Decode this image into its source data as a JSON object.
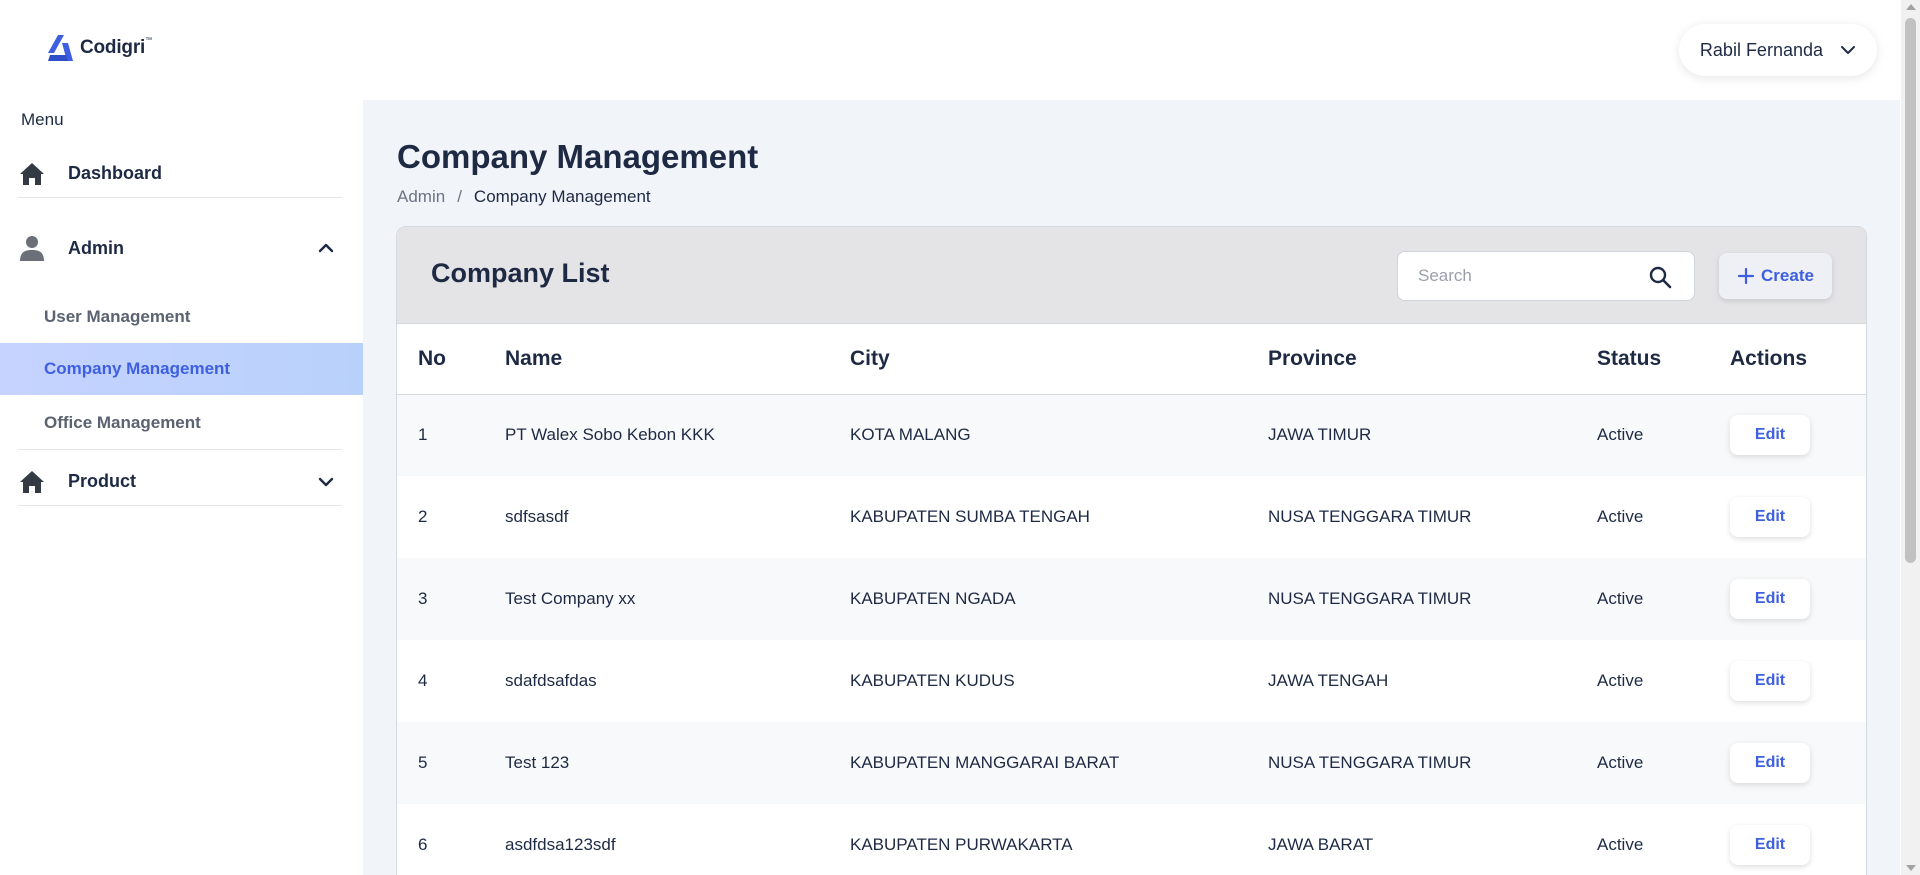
{
  "app": {
    "logo_text": "Codigri",
    "logo_tm": "™"
  },
  "sidebar": {
    "menu_label": "Menu",
    "items": [
      {
        "label": "Dashboard",
        "icon": "home-icon"
      },
      {
        "label": "Admin",
        "icon": "user-icon",
        "expanded": true
      },
      {
        "label": "Product",
        "icon": "home-icon",
        "expanded": false
      }
    ],
    "admin_subitems": [
      {
        "label": "User Management"
      },
      {
        "label": "Company Management",
        "active": true
      },
      {
        "label": "Office Management"
      }
    ]
  },
  "header": {
    "user_name": "Rabil Fernanda"
  },
  "page": {
    "title": "Company Management",
    "breadcrumb": [
      "Admin",
      "/",
      "Company Management"
    ]
  },
  "card": {
    "title": "Company List",
    "search_placeholder": "Search",
    "create_label": "Create"
  },
  "table": {
    "columns": [
      "No",
      "Name",
      "City",
      "Province",
      "Status",
      "Actions"
    ],
    "edit_label": "Edit",
    "rows": [
      {
        "no": "1",
        "name": "PT Walex Sobo Kebon KKK",
        "city": "KOTA MALANG",
        "province": "JAWA TIMUR",
        "status": "Active"
      },
      {
        "no": "2",
        "name": "sdfsasdf",
        "city": "KABUPATEN SUMBA TENGAH",
        "province": "NUSA TENGGARA TIMUR",
        "status": "Active"
      },
      {
        "no": "3",
        "name": "Test Company xx",
        "city": "KABUPATEN NGADA",
        "province": "NUSA TENGGARA TIMUR",
        "status": "Active"
      },
      {
        "no": "4",
        "name": "sdafdsafdas",
        "city": "KABUPATEN KUDUS",
        "province": "JAWA TENGAH",
        "status": "Active"
      },
      {
        "no": "5",
        "name": "Test 123",
        "city": "KABUPATEN MANGGARAI BARAT",
        "province": "NUSA TENGGARA TIMUR",
        "status": "Active"
      },
      {
        "no": "6",
        "name": "asdfdsa123sdf",
        "city": "KABUPATEN PURWAKARTA",
        "province": "JAWA BARAT",
        "status": "Active"
      }
    ]
  },
  "colors": {
    "accent": "#3d5fe0",
    "text": "#1e2a44",
    "active_bg": "#c6d3ff",
    "main_bg": "#f1f4f9",
    "card_head_bg": "#e4e4e6"
  }
}
